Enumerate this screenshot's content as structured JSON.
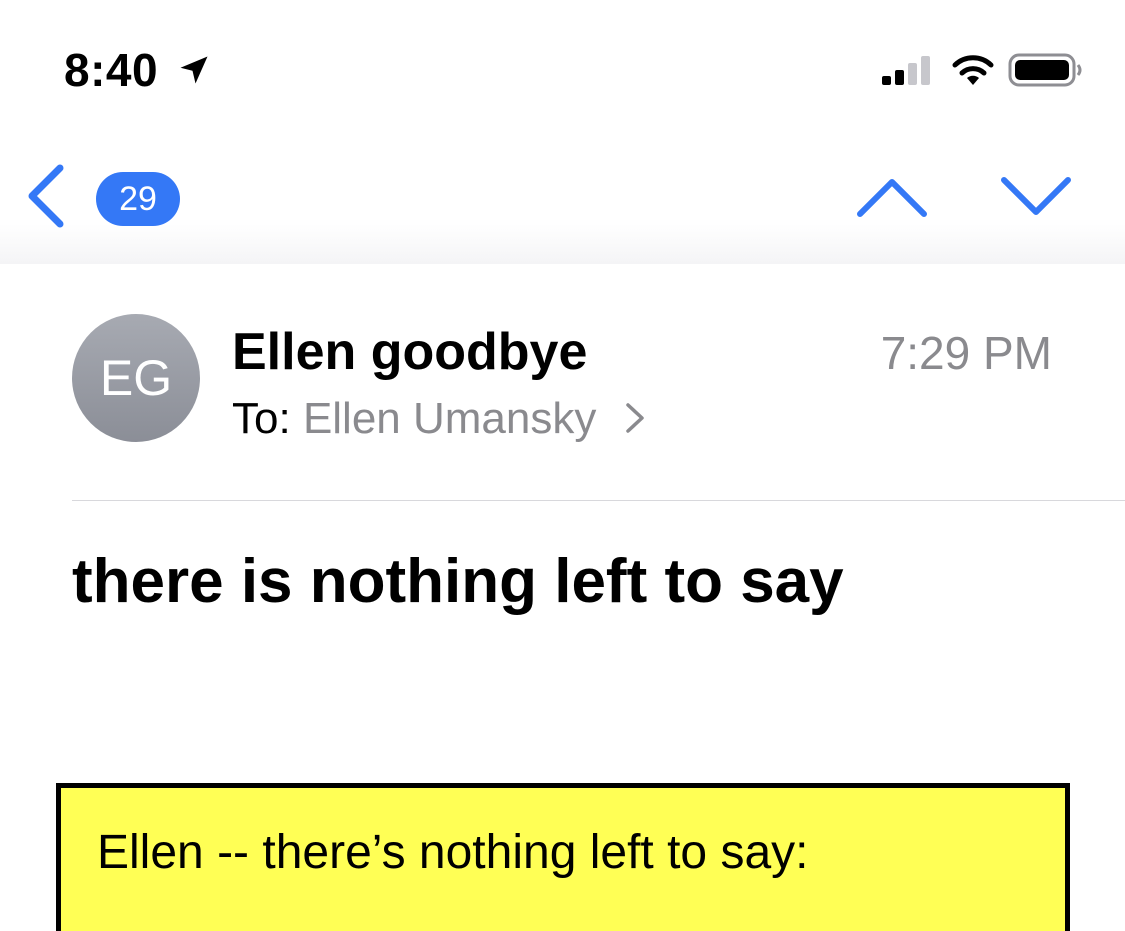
{
  "status_bar": {
    "time": "8:40",
    "icons": [
      "location-arrow-icon",
      "cellular-signal-icon",
      "wifi-icon",
      "battery-icon"
    ]
  },
  "nav": {
    "unread_count": "29",
    "accent_color": "#3478f6"
  },
  "message": {
    "avatar_initials": "EG",
    "sender": "Ellen goodbye",
    "time": "7:29 PM",
    "to_label": "To:",
    "recipient": "Ellen Umansky",
    "subject": "there is nothing left to say",
    "body_box": {
      "text": "Ellen -- there’s nothing left to say:",
      "background": "#ffff55"
    }
  }
}
